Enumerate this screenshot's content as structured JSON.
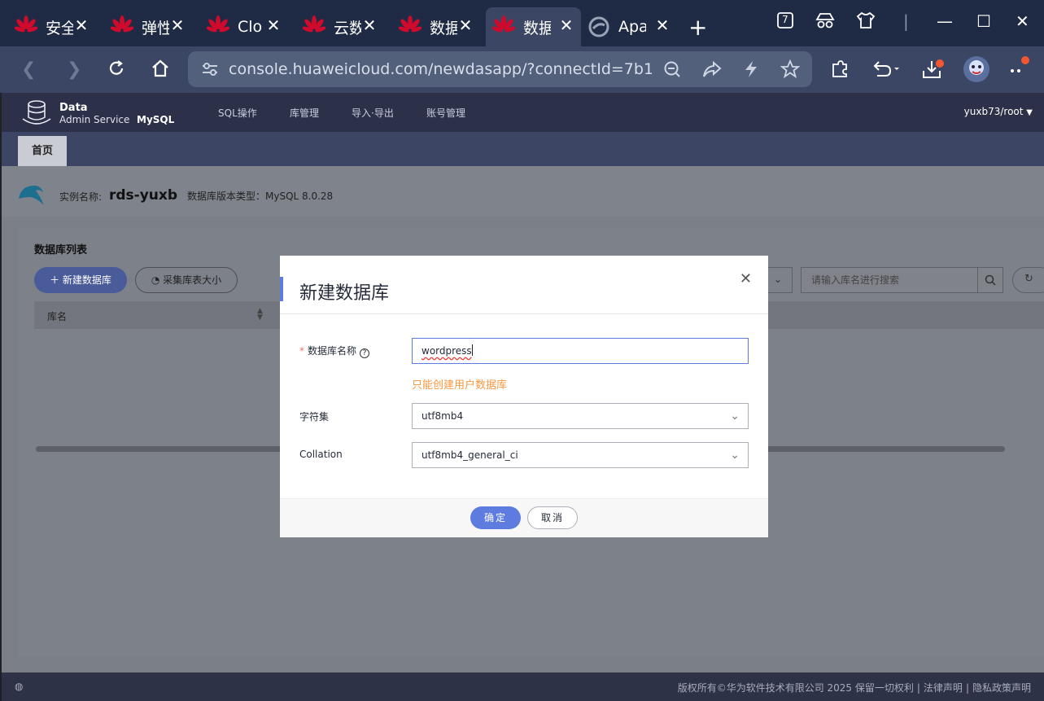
{
  "browser": {
    "tabs": [
      {
        "title": "安全"
      },
      {
        "title": "弹性"
      },
      {
        "title": "Clo"
      },
      {
        "title": "云数"
      },
      {
        "title": "数据"
      },
      {
        "title": "数据"
      },
      {
        "title": "Apa"
      }
    ],
    "tab_count_badge": "7",
    "url": "console.huaweicloud.com/newdasapp/?connectId=7b188..."
  },
  "app": {
    "logo_line1": "Data",
    "logo_line2": "Admin Service",
    "logo_engine": "MySQL",
    "nav": [
      "SQL操作",
      "库管理",
      "导入·导出",
      "账号管理"
    ],
    "user": "yuxb73/root",
    "home_tab": "首页"
  },
  "instance": {
    "name_label": "实例名称:",
    "name": "rds-yuxb",
    "version_label": "数据库版本类型：MySQL 8.0.28"
  },
  "db_list": {
    "title": "数据库列表",
    "new_button": "新建数据库",
    "collect_button": "采集库表大小",
    "search_placeholder": "请输入库名进行搜索",
    "col_name": "库名"
  },
  "footer": {
    "copyright": "版权所有©华为软件技术有限公司 2025 保留一切权利",
    "legal": "法律声明",
    "privacy": "隐私政策声明"
  },
  "modal": {
    "title": "新建数据库",
    "db_name_label": "数据库名称",
    "db_name_value": "wordpress",
    "tip": "只能创建用户数据库",
    "charset_label": "字符集",
    "charset_value": "utf8mb4",
    "collation_label": "Collation",
    "collation_value": "utf8mb4_general_ci",
    "ok": "确定",
    "cancel": "取消"
  },
  "colors": {
    "accent": "#5e7ce0",
    "warning": "#fa9841",
    "required": "#f66f6a",
    "huawei_red": "#cf0a2c"
  }
}
